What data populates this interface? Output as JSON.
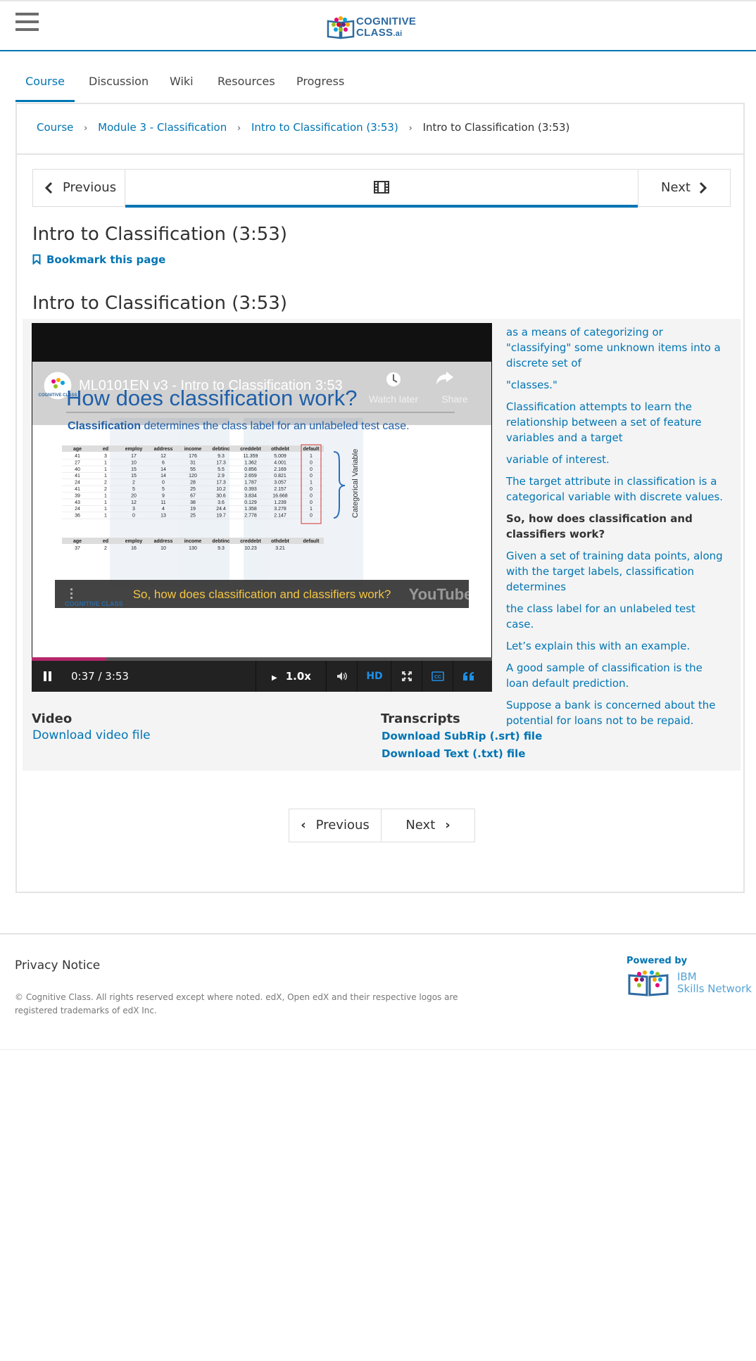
{
  "header": {
    "menu_icon": "hamburger-menu-icon",
    "logo": {
      "line1": "COGNITIVE",
      "line2": "CLASS",
      "line3": ".ai"
    }
  },
  "tabs": [
    {
      "label": "Course",
      "active": true
    },
    {
      "label": "Discussion"
    },
    {
      "label": "Wiki"
    },
    {
      "label": "Resources"
    },
    {
      "label": "Progress"
    }
  ],
  "breadcrumb": {
    "items": [
      "Course",
      "Module 3 - Classification",
      "Intro to Classification (3:53)"
    ],
    "current": "Intro to Classification (3:53)",
    "separator_icon": "chevron-right-icon"
  },
  "sequence_nav": {
    "previous": "Previous",
    "next": "Next",
    "unit_icon": "film-icon"
  },
  "unit": {
    "title": "Intro to Classification (3:53)",
    "bookmark": "Bookmark this page",
    "vertical_title": "Intro to Classification (3:53)"
  },
  "video": {
    "youtube_title": "ML0101EN v3 - Intro to Classification 3:53",
    "watch_later": "Watch later",
    "share": "Share",
    "slide_heading": "How does classification work?",
    "slide_bold": "Classification",
    "slide_text": "determines the class label for an unlabeled test case.",
    "table_headers": [
      "age",
      "ed",
      "employ",
      "address",
      "income",
      "debtinc",
      "creddebt",
      "othdebt",
      "default"
    ],
    "table_rows": [
      [
        "41",
        "3",
        "17",
        "12",
        "176",
        "9.3",
        "11.359",
        "5.009",
        "1"
      ],
      [
        "27",
        "1",
        "10",
        "6",
        "31",
        "17.3",
        "1.362",
        "4.001",
        "0"
      ],
      [
        "40",
        "1",
        "15",
        "14",
        "55",
        "5.5",
        "0.856",
        "2.169",
        "0"
      ],
      [
        "41",
        "1",
        "15",
        "14",
        "120",
        "2.9",
        "2.659",
        "0.821",
        "0"
      ],
      [
        "24",
        "2",
        "2",
        "0",
        "28",
        "17.3",
        "1.787",
        "3.057",
        "1"
      ],
      [
        "41",
        "2",
        "5",
        "5",
        "25",
        "10.2",
        "0.393",
        "2.157",
        "0"
      ],
      [
        "39",
        "1",
        "20",
        "9",
        "67",
        "30.6",
        "3.834",
        "16.668",
        "0"
      ],
      [
        "43",
        "1",
        "12",
        "11",
        "38",
        "3.6",
        "0.129",
        "1.239",
        "0"
      ],
      [
        "24",
        "1",
        "3",
        "4",
        "19",
        "24.4",
        "1.358",
        "3.278",
        "1"
      ],
      [
        "36",
        "1",
        "0",
        "13",
        "25",
        "19.7",
        "2.778",
        "2.147",
        "0"
      ]
    ],
    "test_row": [
      "37",
      "2",
      "16",
      "10",
      "130",
      "9.3",
      "10.23",
      "3.21",
      ""
    ],
    "categorical_label": "Categorical Variable",
    "caption": "So, how does classification and classifiers work?",
    "slide_logo": "COGNITIVE CLASS",
    "watermark": "YouTube",
    "time": "0:37 / 3:53",
    "progress": 0.162,
    "speed": "1.0x",
    "hd": "HD",
    "accent_color": "#b5276a",
    "caption_color": "#f5c542"
  },
  "transcript": [
    {
      "text": "as a means of categorizing or \"classifying\" some unknown items into a discrete set of"
    },
    {
      "text": "\"classes.\""
    },
    {
      "text": "Classification attempts to learn the relationship between a set of feature variables and a target"
    },
    {
      "text": "variable of interest."
    },
    {
      "text": "The target attribute in classification is a categorical variable with discrete values."
    },
    {
      "text": "So, how does classification and classifiers work?",
      "current": true
    },
    {
      "text": "Given a set of training data points, along with the target labels, classification determines"
    },
    {
      "text": "the class label for an unlabeled test case."
    },
    {
      "text": "Let’s explain this with an example."
    },
    {
      "text": "A good sample of classification is the loan default prediction."
    },
    {
      "text": "Suppose a bank is concerned about the potential for loans not to be repaid."
    }
  ],
  "downloads": {
    "video_title": "Video",
    "video_link": "Download video file",
    "transcripts_title": "Transcripts",
    "srt_link": "Download SubRip (.srt) file",
    "txt_link": "Download Text (.txt) file"
  },
  "bottom_nav": {
    "previous": "Previous",
    "next": "Next"
  },
  "footer": {
    "privacy": "Privacy Notice",
    "copyright": "© Cognitive Class. All rights reserved except where noted. edX, Open edX and their respective logos are registered trademarks of edX Inc.",
    "powered_by": "Powered by",
    "ibm_line1": "IBM",
    "ibm_line2": "Skills Network"
  },
  "colors": {
    "link": "#0075b4",
    "brand": "#2d6aa0"
  }
}
